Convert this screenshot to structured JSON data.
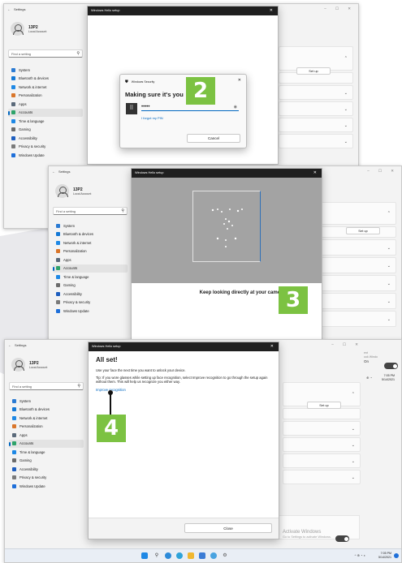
{
  "settings": {
    "title": "Settings",
    "user_name": "13P2",
    "user_sub": "Local Account",
    "search_placeholder": "Find a setting",
    "nav": [
      "System",
      "Bluetooth & devices",
      "Network & internet",
      "Personalization",
      "Apps",
      "Accounts",
      "Time & language",
      "Gaming",
      "Accessibility",
      "Privacy & security",
      "Windows Update"
    ],
    "nav_icon_colors": [
      "#2b7bd3",
      "#1479d6",
      "#1e88e5",
      "#d9762b",
      "#5b6a7a",
      "#2ea36a",
      "#1e88e5",
      "#6b6b6b",
      "#1f5fbf",
      "#7a7a7a",
      "#1e6fd9"
    ],
    "setup_label": "Set up"
  },
  "hello": {
    "title": "Windows Hello setup",
    "close": "✕"
  },
  "security": {
    "header": "Windows Security",
    "heading": "Making sure it's you",
    "pin_mask": "•••••",
    "forgot_link": "I forgot my PIN",
    "cancel": "Cancel"
  },
  "camera": {
    "message": "Keep looking directly at your camera."
  },
  "allset": {
    "heading": "All set!",
    "line1": "Use your face the next time you want to unlock your device.",
    "tip": "Tip: If you wore glasses while setting up face recognition, select Improve recognition to go through the setup again without them. This will help us recognize you either way.",
    "improve_link": "Improve recognition",
    "close_button": "Close",
    "bottom_note": "For improved security, only allow Windows Hello sign-in for Microsoft accounts on this device (Recommended)"
  },
  "steps": {
    "step2": "2",
    "step3": "3",
    "step4": "4"
  },
  "activate": {
    "line1": "Activate Windows",
    "line2": "Go to Settings to activate Windows."
  },
  "side_text": {
    "on_label": "On",
    "partial": "ook Windo",
    "partial_prefix": "ent"
  },
  "taskbar": {
    "time": "7:05 PM",
    "date": "5/14/2021"
  },
  "colors": {
    "accent": "#0067c0",
    "badge": "#7cc242",
    "dark_title": "#1f1f1f"
  }
}
